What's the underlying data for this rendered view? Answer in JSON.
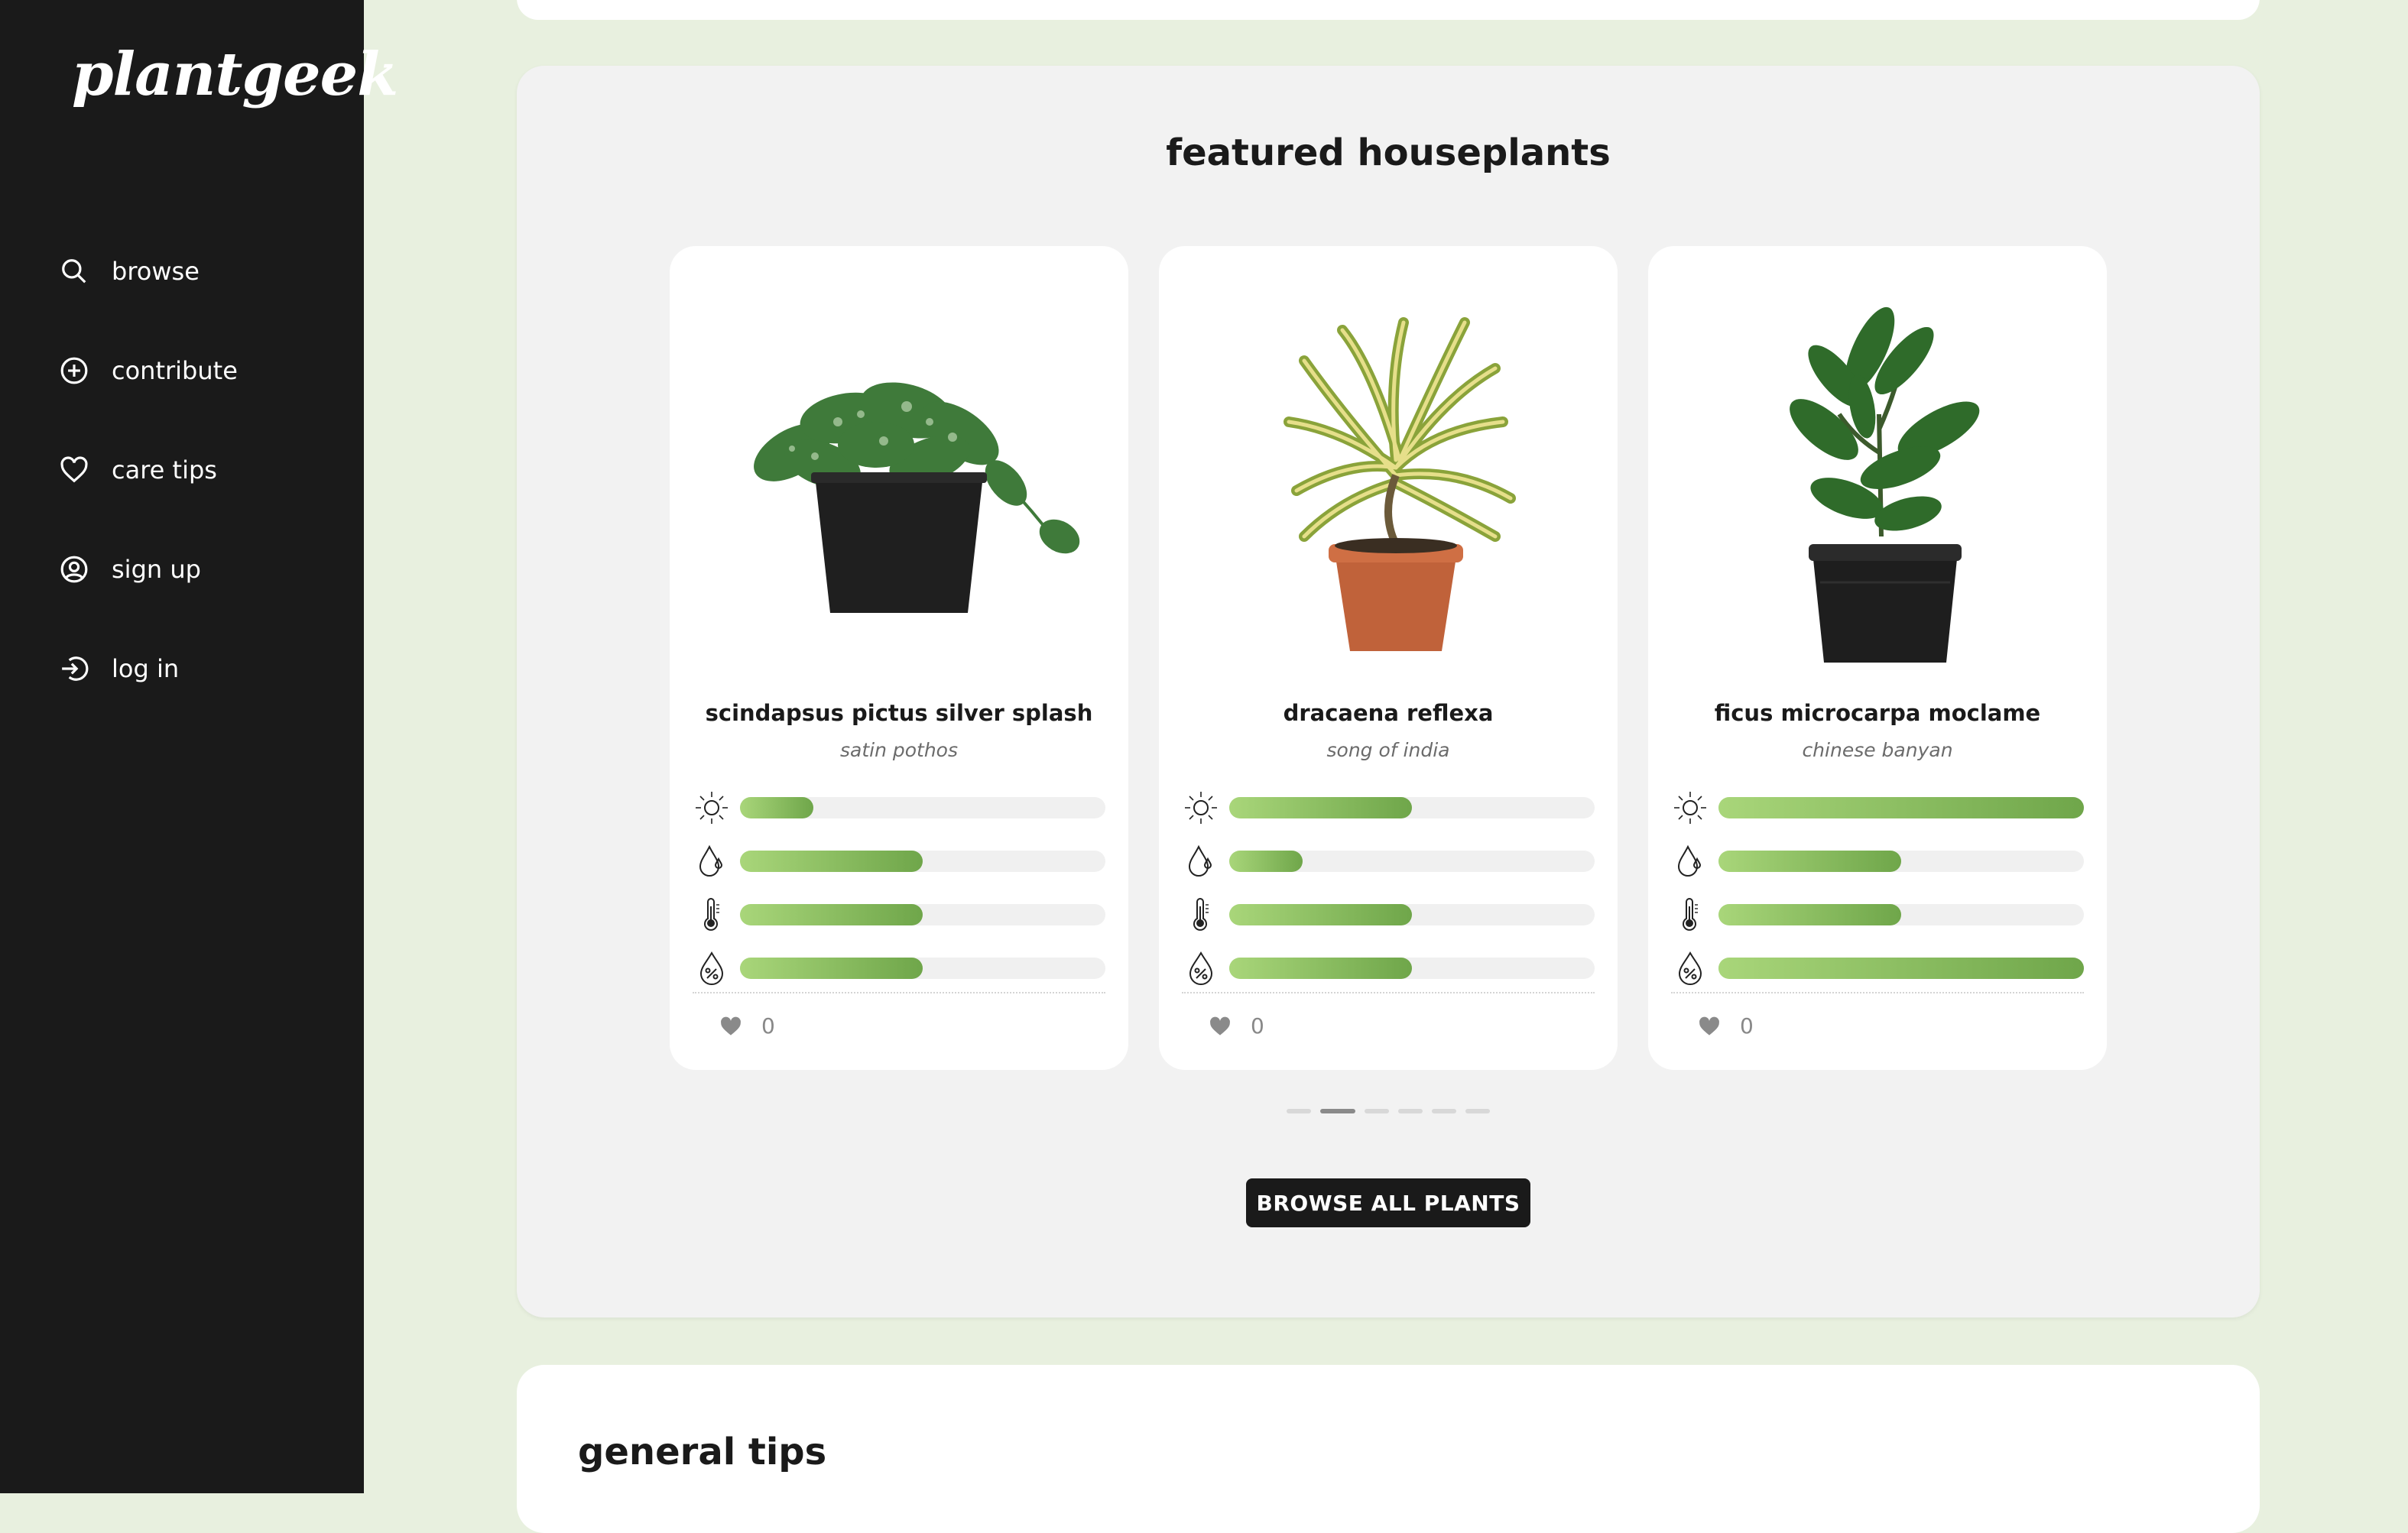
{
  "brand": {
    "logo_text": "plantgeek"
  },
  "nav": [
    {
      "label": "browse",
      "icon": "search-icon"
    },
    {
      "label": "contribute",
      "icon": "plus-circle-icon"
    },
    {
      "label": "care tips",
      "icon": "heart-icon"
    },
    {
      "label": "sign up",
      "icon": "user-circle-icon"
    },
    {
      "label": "log in",
      "icon": "login-icon"
    }
  ],
  "featured": {
    "title": "featured houseplants",
    "plants": [
      {
        "name": "scindapsus pictus silver splash",
        "common": "satin pothos",
        "light": 0.2,
        "water": 0.5,
        "temperature": 0.5,
        "humidity": 0.5,
        "likes": "0"
      },
      {
        "name": "dracaena reflexa",
        "common": "song of india",
        "light": 0.5,
        "water": 0.2,
        "temperature": 0.5,
        "humidity": 0.5,
        "likes": "0"
      },
      {
        "name": "ficus microcarpa moclame",
        "common": "chinese banyan",
        "light": 1.0,
        "water": 0.5,
        "temperature": 0.5,
        "humidity": 1.0,
        "likes": "0"
      }
    ],
    "carousel": {
      "pages": 6,
      "active": 1
    },
    "browse_button": "BROWSE ALL PLANTS"
  },
  "general_tips": {
    "title": "general tips"
  },
  "colors": {
    "sidebar": "#1a1a1a",
    "page_bg": "#e8f0df",
    "bar_start": "#a9d67a",
    "bar_end": "#6fa64a"
  }
}
